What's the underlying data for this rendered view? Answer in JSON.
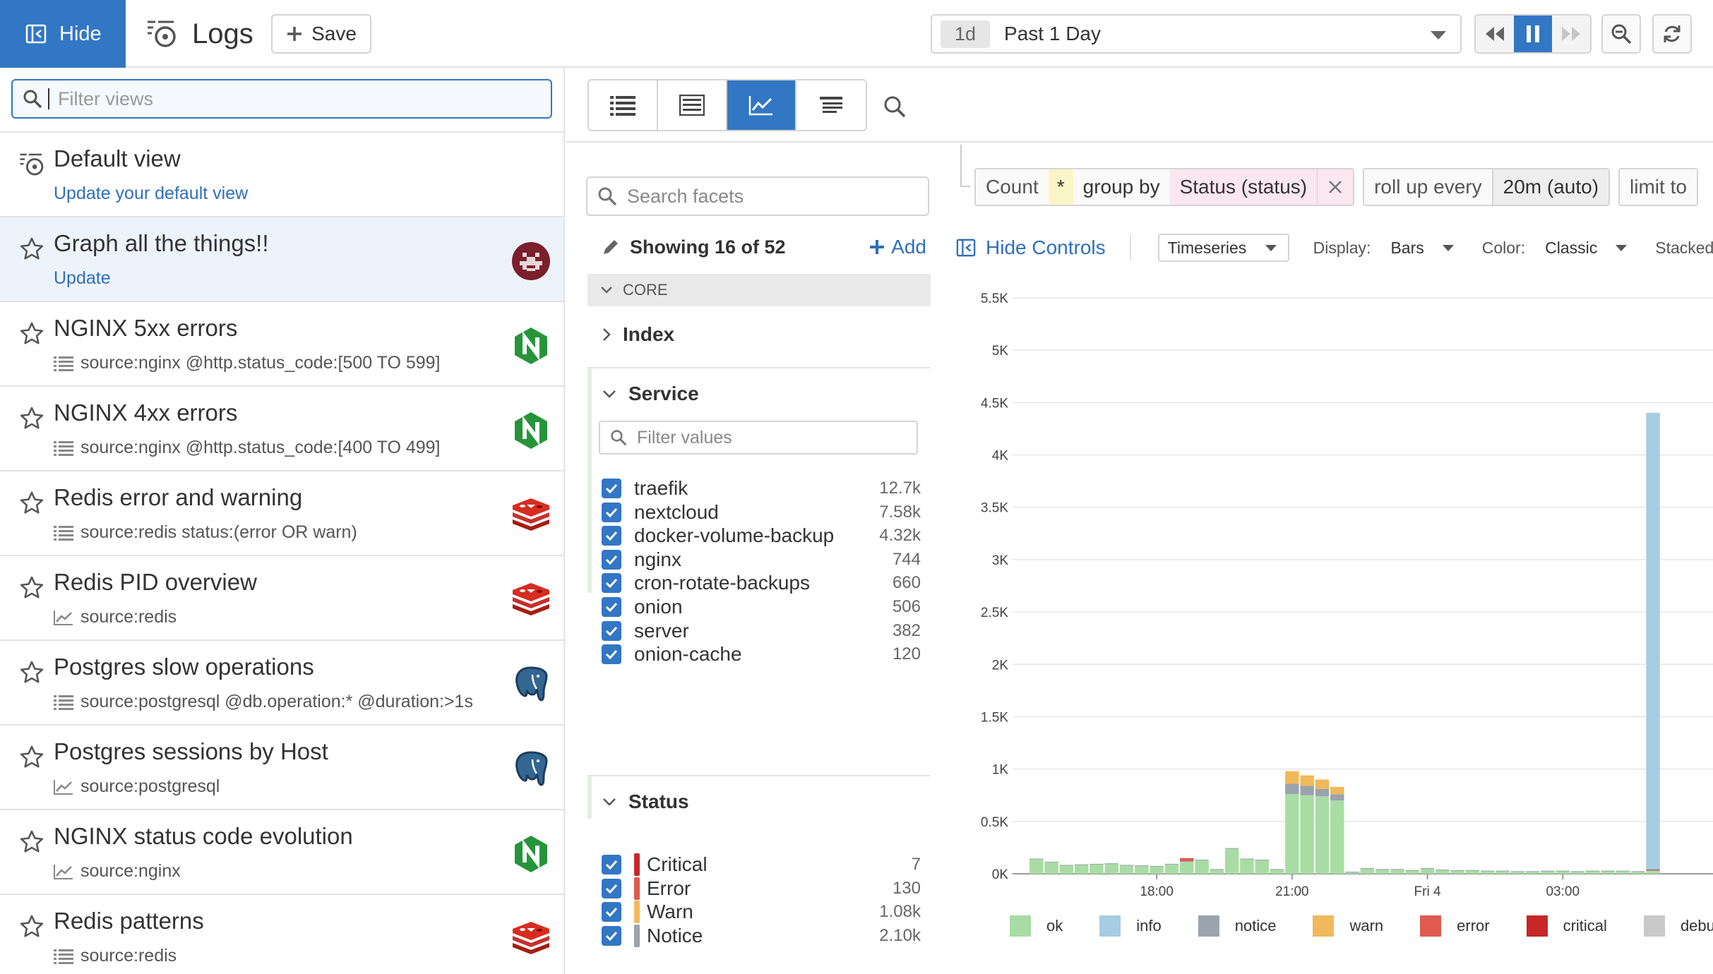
{
  "topbar": {
    "hide_label": "Hide",
    "app_title": "Logs",
    "save_label": "Save",
    "time_chip": "1d",
    "time_label": "Past 1 Day"
  },
  "views": {
    "filter_placeholder": "Filter views",
    "items": [
      {
        "title": "Default view",
        "sub": "Update your default view",
        "sub_type": "link",
        "icon": "default-view-icon",
        "logo": "",
        "starred": false
      },
      {
        "title": "Graph all the things!!",
        "sub": "Update",
        "sub_type": "link",
        "icon": "star-icon",
        "logo": "avatar",
        "starred": true
      },
      {
        "title": "NGINX 5xx errors",
        "sub": "source:nginx @http.status_code:[500 TO 599]",
        "sub_type": "list",
        "icon": "star-icon",
        "logo": "nginx"
      },
      {
        "title": "NGINX 4xx errors",
        "sub": "source:nginx @http.status_code:[400 TO 499]",
        "sub_type": "list",
        "icon": "star-icon",
        "logo": "nginx"
      },
      {
        "title": "Redis error and warning",
        "sub": "source:redis status:(error OR warn)",
        "sub_type": "list",
        "icon": "star-icon",
        "logo": "redis"
      },
      {
        "title": "Redis PID overview",
        "sub": "source:redis",
        "sub_type": "graph",
        "icon": "star-icon",
        "logo": "redis"
      },
      {
        "title": "Postgres slow operations",
        "sub": "source:postgresql @db.operation:* @duration:>1s",
        "sub_type": "list",
        "icon": "star-icon",
        "logo": "postgres"
      },
      {
        "title": "Postgres sessions by Host",
        "sub": "source:postgresql",
        "sub_type": "graph",
        "icon": "star-icon",
        "logo": "postgres"
      },
      {
        "title": "NGINX status code evolution",
        "sub": "source:nginx",
        "sub_type": "graph",
        "icon": "star-icon",
        "logo": "nginx"
      },
      {
        "title": "Redis patterns",
        "sub": "source:redis",
        "sub_type": "list",
        "icon": "star-icon",
        "logo": "redis"
      }
    ]
  },
  "facets": {
    "search_placeholder": "Search facets",
    "showing": "Showing 16 of 52",
    "add_label": "Add",
    "core_label": "CORE",
    "index_label": "Index",
    "service_label": "Service",
    "filter_values_placeholder": "Filter values",
    "services": [
      {
        "name": "traefik",
        "count": "12.7k"
      },
      {
        "name": "nextcloud",
        "count": "7.58k"
      },
      {
        "name": "docker-volume-backup",
        "count": "4.32k"
      },
      {
        "name": "nginx",
        "count": "744"
      },
      {
        "name": "cron-rotate-backups",
        "count": "660"
      },
      {
        "name": "onion",
        "count": "506"
      },
      {
        "name": "server",
        "count": "382"
      },
      {
        "name": "onion-cache",
        "count": "120"
      }
    ],
    "status_label": "Status",
    "statuses": [
      {
        "name": "Critical",
        "count": "7",
        "color": "#c62828"
      },
      {
        "name": "Error",
        "count": "130",
        "color": "#e05a4f"
      },
      {
        "name": "Warn",
        "count": "1.08k",
        "color": "#f0b95c"
      },
      {
        "name": "Notice",
        "count": "2.10k",
        "color": "#9aa3ae"
      }
    ]
  },
  "query": {
    "count": "Count",
    "star": "*",
    "group_by": "group by",
    "group_value": "Status (status)",
    "roll_up": "roll up every",
    "roll_value": "20m (auto)",
    "limit": "limit to"
  },
  "controls": {
    "hide_controls": "Hide Controls",
    "viz": "Timeseries",
    "display_label": "Display:",
    "display_value": "Bars",
    "color_label": "Color:",
    "color_value": "Classic",
    "stacked": "Stacked"
  },
  "chart_data": {
    "type": "bar",
    "stacked": true,
    "ylim": [
      0,
      5500
    ],
    "yticks": [
      "0K",
      "0.5K",
      "1K",
      "1.5K",
      "2K",
      "2.5K",
      "3K",
      "3.5K",
      "4K",
      "4.5K",
      "5K",
      "5.5K"
    ],
    "xticks": [
      {
        "label": "18:00",
        "index": 8
      },
      {
        "label": "21:00",
        "index": 17
      },
      {
        "label": "Fri 4",
        "index": 26
      },
      {
        "label": "03:00",
        "index": 35
      }
    ],
    "series": [
      {
        "name": "ok",
        "color": "#a9dca4",
        "values": [
          140,
          110,
          80,
          85,
          90,
          95,
          80,
          75,
          70,
          90,
          115,
          130,
          40,
          240,
          140,
          130,
          40,
          760,
          750,
          740,
          700,
          15,
          50,
          40,
          40,
          30,
          50,
          35,
          30,
          30,
          25,
          25,
          20,
          20,
          25,
          25,
          20,
          25,
          25,
          25,
          20,
          30
        ]
      },
      {
        "name": "info",
        "color": "#a6cde2",
        "values": [
          0,
          0,
          0,
          0,
          0,
          0,
          0,
          0,
          0,
          0,
          0,
          0,
          0,
          0,
          0,
          0,
          0,
          0,
          0,
          0,
          0,
          0,
          0,
          0,
          0,
          0,
          0,
          0,
          0,
          0,
          0,
          0,
          0,
          0,
          0,
          0,
          0,
          0,
          0,
          0,
          0,
          4360
        ]
      },
      {
        "name": "notice",
        "color": "#9aa3ae",
        "values": [
          5,
          5,
          5,
          5,
          5,
          5,
          5,
          5,
          5,
          5,
          5,
          5,
          5,
          5,
          5,
          5,
          5,
          100,
          90,
          70,
          60,
          5,
          5,
          5,
          5,
          5,
          5,
          5,
          5,
          5,
          5,
          5,
          5,
          5,
          5,
          5,
          5,
          5,
          5,
          5,
          5,
          5
        ]
      },
      {
        "name": "warn",
        "color": "#f0b95c",
        "values": [
          0,
          0,
          0,
          0,
          0,
          0,
          0,
          0,
          0,
          0,
          0,
          0,
          0,
          0,
          0,
          0,
          0,
          120,
          100,
          90,
          70,
          0,
          0,
          0,
          0,
          0,
          0,
          0,
          0,
          0,
          0,
          0,
          0,
          0,
          0,
          0,
          0,
          0,
          0,
          0,
          0,
          0
        ]
      },
      {
        "name": "error",
        "color": "#e05a4f",
        "values": [
          0,
          0,
          0,
          0,
          0,
          0,
          0,
          0,
          0,
          0,
          30,
          0,
          0,
          0,
          0,
          0,
          0,
          0,
          0,
          0,
          0,
          0,
          0,
          0,
          0,
          0,
          0,
          0,
          0,
          0,
          0,
          0,
          0,
          0,
          0,
          0,
          0,
          0,
          0,
          0,
          0,
          0
        ]
      },
      {
        "name": "critical",
        "color": "#c62828",
        "values": [
          0,
          0,
          0,
          0,
          0,
          0,
          0,
          0,
          0,
          0,
          0,
          0,
          0,
          0,
          0,
          0,
          0,
          0,
          0,
          0,
          0,
          0,
          0,
          0,
          0,
          0,
          0,
          0,
          0,
          0,
          0,
          0,
          0,
          0,
          0,
          0,
          0,
          0,
          0,
          0,
          0,
          7
        ]
      },
      {
        "name": "debug",
        "color": "#c9c9c9",
        "values": [
          0,
          0,
          0,
          0,
          0,
          0,
          0,
          0,
          0,
          0,
          0,
          0,
          0,
          0,
          0,
          0,
          0,
          0,
          0,
          0,
          0,
          0,
          0,
          0,
          0,
          0,
          0,
          0,
          0,
          0,
          0,
          0,
          0,
          0,
          0,
          0,
          0,
          0,
          0,
          0,
          0,
          0
        ]
      }
    ]
  }
}
